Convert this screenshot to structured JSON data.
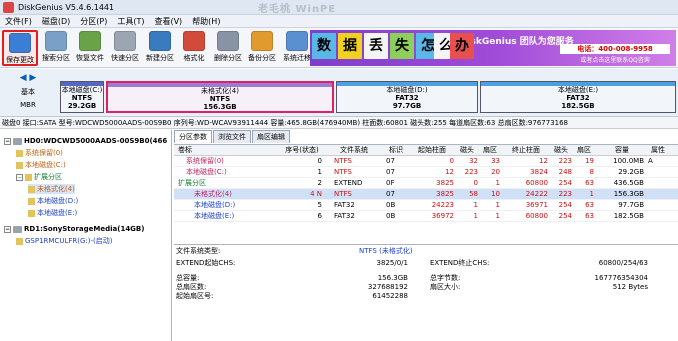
{
  "window": {
    "title": "DiskGenius V5.4.6.1441",
    "watermark": "老毛桃 WinPE"
  },
  "menu": [
    "文件(F)",
    "磁盘(D)",
    "分区(P)",
    "工具(T)",
    "查看(V)",
    "帮助(H)"
  ],
  "toolbar": [
    {
      "label": "保存更改",
      "icon": "save-icon",
      "color": "#3b7fd4"
    },
    {
      "label": "搜索分区",
      "icon": "search-icon",
      "color": "#7aa0c8"
    },
    {
      "label": "恢复文件",
      "icon": "restore-icon",
      "color": "#6aa24a"
    },
    {
      "label": "快速分区",
      "icon": "quick-partition-icon",
      "color": "#9ca6b2"
    },
    {
      "label": "新建分区",
      "icon": "new-partition-icon",
      "color": "#3a7bc0"
    },
    {
      "label": "格式化",
      "icon": "format-icon",
      "color": "#d24a3a"
    },
    {
      "label": "删除分区",
      "icon": "delete-icon",
      "color": "#8894a6"
    },
    {
      "label": "备份分区",
      "icon": "backup-icon",
      "color": "#e09a2e"
    },
    {
      "label": "系统迁移",
      "icon": "migrate-icon",
      "color": "#5a8fd0"
    }
  ],
  "ad": {
    "blocks": [
      {
        "text": "数",
        "color": "#5ab8e8"
      },
      {
        "text": "据",
        "color": "#f0d020"
      },
      {
        "text": "丢",
        "color": "#f4f4f4"
      },
      {
        "text": "失",
        "color": "#8ccf5a"
      },
      {
        "text": "怎",
        "color": "#5ab8e8"
      },
      {
        "text": "么",
        "color": "#f4f4f4"
      },
      {
        "text": "办",
        "color": "#e85050"
      }
    ],
    "team": "DiskGenius 团队为您服务",
    "phone": "电话：400-008-9958",
    "qq": "或者点击这里联系QQ咨询"
  },
  "disknav": {
    "line1": "基本",
    "line2": "MBR"
  },
  "partitions": [
    {
      "name": "本地磁盘(C:)",
      "fs": "NTFS",
      "size": "29.2GB",
      "color": "#5566c8"
    },
    {
      "name": "未格式化(4)",
      "fs": "NTFS",
      "size": "156.3GB",
      "color": "#9a7bd8"
    },
    {
      "name": "本地磁盘(D:)",
      "fs": "FAT32",
      "size": "97.7GB",
      "color": "#4aa0e0"
    },
    {
      "name": "本地磁盘(E:)",
      "fs": "FAT32",
      "size": "182.5GB",
      "color": "#4aa0e0"
    }
  ],
  "infobar": "磁盘0 接口:SATA  型号:WDCWD5000AADS-00S9B0 序列号:WD-WCAV93911444  容量:465.8GB(476940MB)  柱面数:60801  磁头数:255  每道扇区数:63  总扇区数:976773168",
  "tree": [
    {
      "label": "HD0:WDCWD5000AADS-00S9B0(466",
      "level": 0,
      "kind": "disk",
      "bold": true,
      "color": "#000"
    },
    {
      "label": "系统保留(0)",
      "level": 1,
      "kind": "part",
      "color": "#c06010"
    },
    {
      "label": "本地磁盘(C:)",
      "level": 1,
      "kind": "part",
      "color": "#c06010"
    },
    {
      "label": "扩展分区",
      "level": 1,
      "kind": "part",
      "color": "#108030"
    },
    {
      "label": "未格式化(4)",
      "level": 2,
      "kind": "part",
      "color": "#c06010",
      "highlight": true
    },
    {
      "label": "本地磁盘(D:)",
      "level": 2,
      "kind": "part",
      "color": "#1a3fd0"
    },
    {
      "label": "本地磁盘(E:)",
      "level": 2,
      "kind": "part",
      "color": "#1a3fd0"
    },
    {
      "label": "RD1:SonyStorageMedia(14GB)",
      "level": 0,
      "kind": "disk",
      "bold": true,
      "color": "#000"
    },
    {
      "label": "GSP1RMCULFR(G:)-(启动)",
      "level": 1,
      "kind": "part",
      "color": "#1a3fd0"
    }
  ],
  "tabs": [
    "分区参数",
    "浏览文件",
    "扇区编辑"
  ],
  "table": {
    "headers": [
      "卷标",
      "序号(状态)",
      "文件系统",
      "标识",
      "起始柱面",
      "磁头",
      "扇区",
      "终止柱面",
      "磁头",
      "扇区",
      "容量",
      "属性"
    ],
    "rows": [
      {
        "cells": [
          "系统保留(0)",
          "0",
          "NTFS",
          "07",
          "0",
          "32",
          "33",
          "12",
          "223",
          "19",
          "100.0MB",
          "A"
        ],
        "indent": 1,
        "color": "pink"
      },
      {
        "cells": [
          "本地磁盘(C:)",
          "1",
          "NTFS",
          "07",
          "12",
          "223",
          "20",
          "3824",
          "248",
          "8",
          "29.2GB",
          ""
        ],
        "indent": 1,
        "color": "pink"
      },
      {
        "cells": [
          "扩展分区",
          "2",
          "EXTEND",
          "0F",
          "3825",
          "0",
          "1",
          "60800",
          "254",
          "63",
          "436.5GB",
          ""
        ],
        "indent": 0,
        "color": "green"
      },
      {
        "cells": [
          "未格式化(4)",
          "4 N",
          "NTFS",
          "07",
          "3825",
          "58",
          "10",
          "24222",
          "223",
          "1",
          "156.3GB",
          ""
        ],
        "indent": 2,
        "color": "pink",
        "selected": true
      },
      {
        "cells": [
          "本地磁盘(D:)",
          "5",
          "FAT32",
          "0B",
          "24223",
          "1",
          "1",
          "36971",
          "254",
          "63",
          "97.7GB",
          ""
        ],
        "indent": 2,
        "color": "blue"
      },
      {
        "cells": [
          "本地磁盘(E:)",
          "6",
          "FAT32",
          "0B",
          "36972",
          "1",
          "1",
          "60800",
          "254",
          "63",
          "182.5GB",
          ""
        ],
        "indent": 2,
        "color": "blue"
      }
    ]
  },
  "details": {
    "fs_type_label": "文件系统类型:",
    "fs_type_value": "NTFS (未格式化)",
    "extend_start_label": "EXTEND起始CHS:",
    "extend_start_value": "3825/0/1",
    "extend_end_label": "EXTEND终止CHS:",
    "extend_end_value": "60800/254/63",
    "capacity_label": "总容量:",
    "capacity_value": "156.3GB",
    "bytes_label": "总字节数:",
    "bytes_value": "167776354304",
    "sectors_label": "总扇区数:",
    "sectors_value": "327688192",
    "sector_size_label": "扇区大小:",
    "sector_size_value": "512 Bytes",
    "start_sector_label": "起始扇区号:",
    "start_sector_value": "61452288"
  }
}
